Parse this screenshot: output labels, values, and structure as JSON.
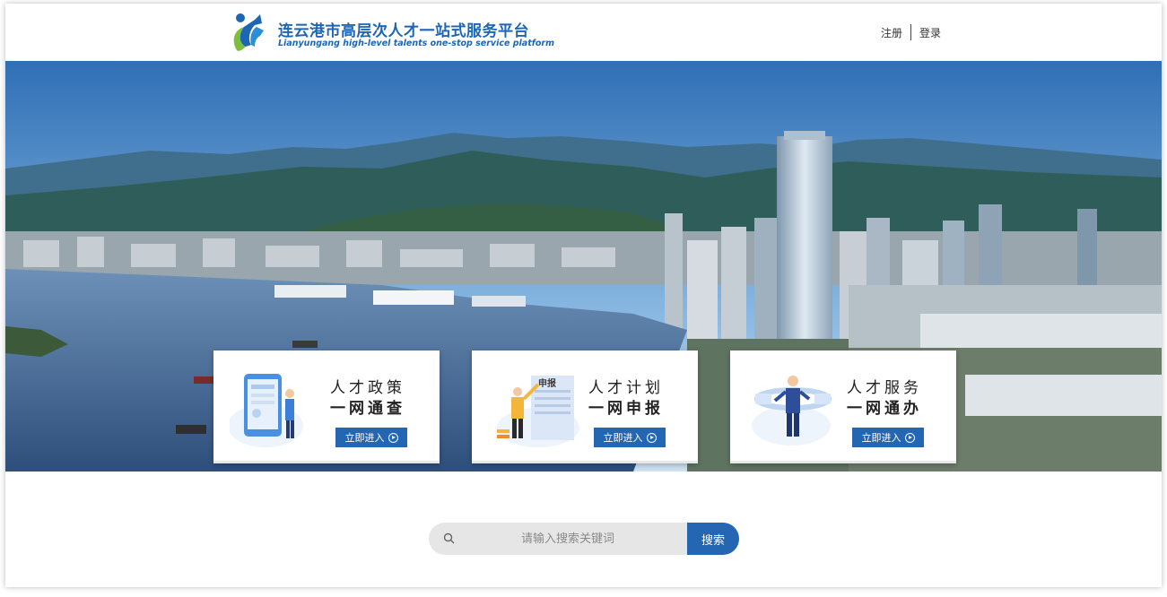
{
  "header": {
    "title_cn": "连云港市高层次人才一站式服务平台",
    "title_en": "Lianyungang high-level talents one-stop service platform",
    "register": "注册",
    "login": "登录"
  },
  "cards": [
    {
      "line1": "人才政策",
      "line2": "一网通查",
      "button": "立即进入"
    },
    {
      "line1": "人才计划",
      "line2": "一网申报",
      "button": "立即进入",
      "doc_label": "申报"
    },
    {
      "line1": "人才服务",
      "line2": "一网通办",
      "button": "立即进入"
    }
  ],
  "search": {
    "placeholder": "请输入搜索关键词",
    "value": "",
    "button": "搜索"
  },
  "colors": {
    "brand": "#1d66b4",
    "button": "#2566b3",
    "logo_green": "#7bbf3c"
  }
}
